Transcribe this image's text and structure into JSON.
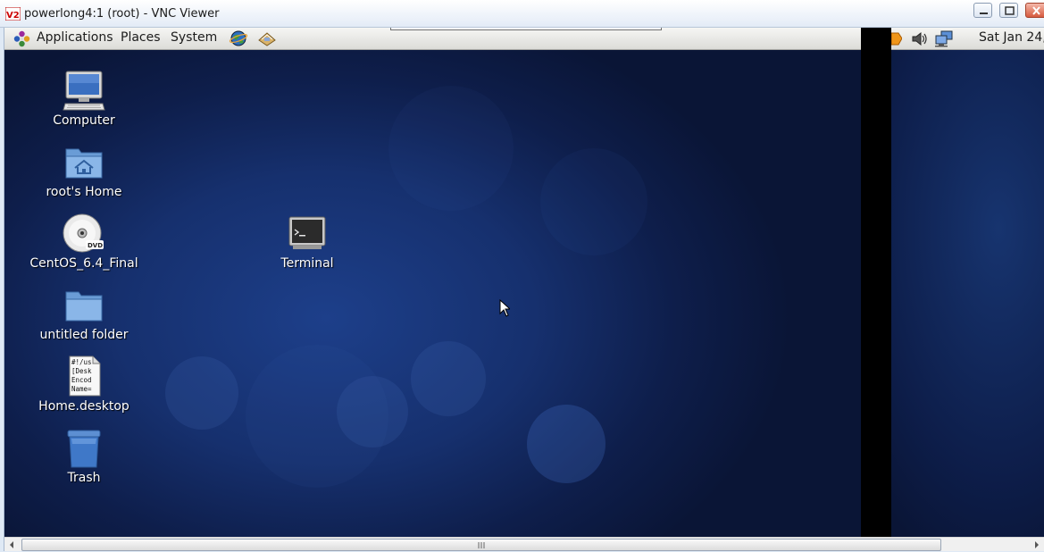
{
  "window": {
    "title": "powerlong4:1 (root) - VNC Viewer",
    "icon": "vnc-viewer-icon"
  },
  "panel": {
    "menus": [
      {
        "label": "Applications"
      },
      {
        "label": "Places"
      },
      {
        "label": "System"
      }
    ],
    "launchers": [
      "web-browser-icon",
      "email-client-icon"
    ],
    "clock": "Sat Jan 24,"
  },
  "desktop": {
    "icons": [
      {
        "label": "Computer",
        "icon": "computer-icon"
      },
      {
        "label": "root's Home",
        "icon": "home-folder-icon"
      },
      {
        "label": "CentOS_6.4_Final",
        "icon": "dvd-icon"
      },
      {
        "label": "untitled folder",
        "icon": "folder-icon"
      },
      {
        "label": "Home.desktop",
        "icon": "desktop-file-icon"
      },
      {
        "label": "Trash",
        "icon": "trash-icon"
      },
      {
        "label": "Terminal",
        "icon": "terminal-icon"
      }
    ],
    "desktop_file_preview": [
      "#!/us",
      "[Desk",
      "Encod",
      "Name="
    ],
    "dvd_badge": "DVD"
  },
  "colors": {
    "desktop_blue": "#16306e",
    "panel_gray": "#e6e6e2"
  }
}
